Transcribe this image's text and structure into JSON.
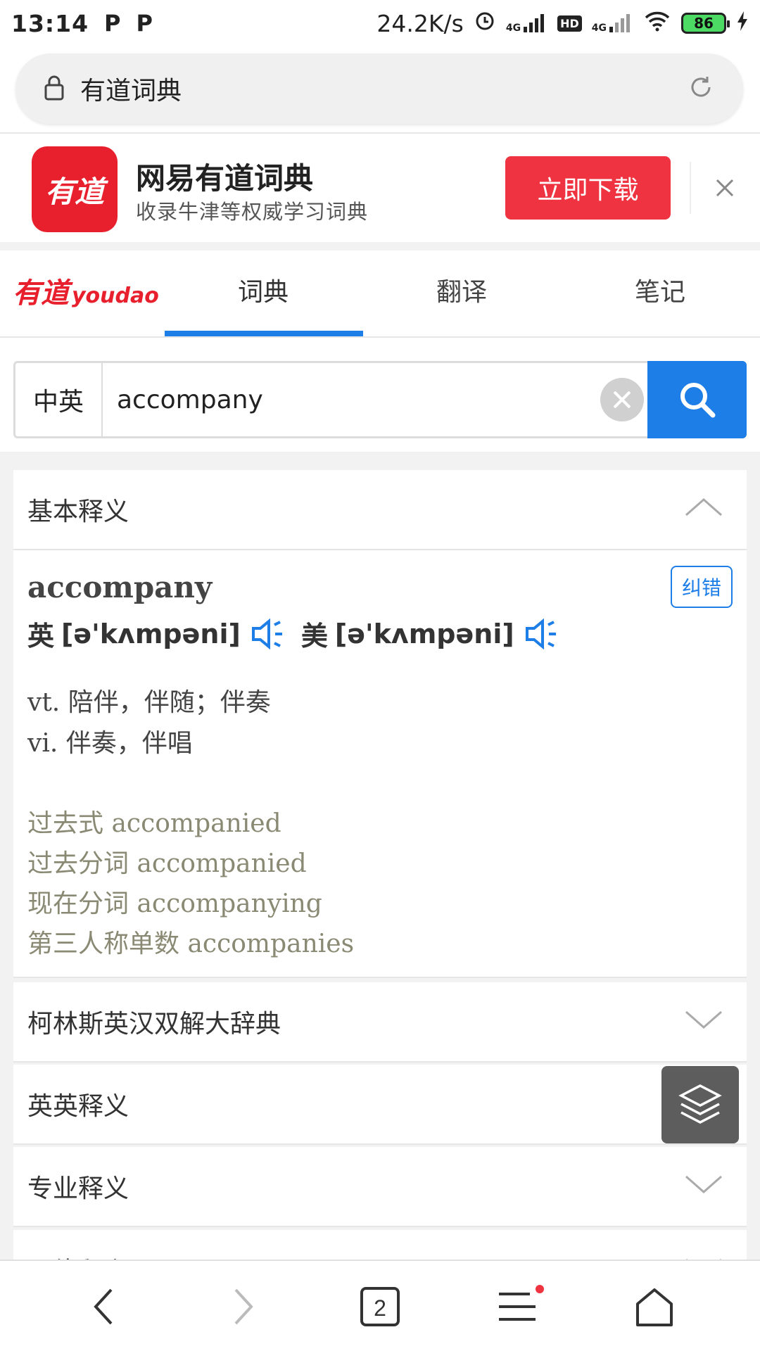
{
  "status": {
    "time": "13:14",
    "p1": "P",
    "p2": "P",
    "speed": "24.2K/s",
    "net1": "4G",
    "hd": "HD",
    "net2": "4G",
    "battery": "86"
  },
  "urlbar": {
    "title": "有道词典",
    "lock_icon": "lock-icon",
    "reload_icon": "reload-icon"
  },
  "banner": {
    "logo_text": "有道",
    "app_name": "网易有道词典",
    "desc": "收录牛津等权威学习词典",
    "download": "立即下载"
  },
  "nav": {
    "logo_cn": "有道",
    "logo_en": "youdao",
    "tabs": [
      "词典",
      "翻译",
      "笔记"
    ],
    "active_tab": 0
  },
  "search": {
    "lang": "中英",
    "query": "accompany"
  },
  "basic": {
    "header": "基本释义",
    "word": "accompany",
    "correct": "纠错",
    "uk_label": "英",
    "uk_phon": "[ə'kʌmpəni]",
    "us_label": "美",
    "us_phon": "[ə'kʌmpəni]",
    "defs": [
      {
        "pos": "vt.",
        "text": "陪伴，伴随；伴奏"
      },
      {
        "pos": "vi.",
        "text": "伴奏，伴唱"
      }
    ],
    "forms": [
      {
        "label": "过去式",
        "value": "accompanied"
      },
      {
        "label": "过去分词",
        "value": "accompanied"
      },
      {
        "label": "现在分词",
        "value": "accompanying"
      },
      {
        "label": "第三人称单数",
        "value": "accompanies"
      }
    ]
  },
  "sections": [
    "柯林斯英汉双解大辞典",
    "英英释义",
    "专业释义",
    "网络释义"
  ],
  "colors": {
    "accent": "#1e7ee8",
    "brand_red": "#e8202d",
    "download_red": "#ef3340"
  }
}
